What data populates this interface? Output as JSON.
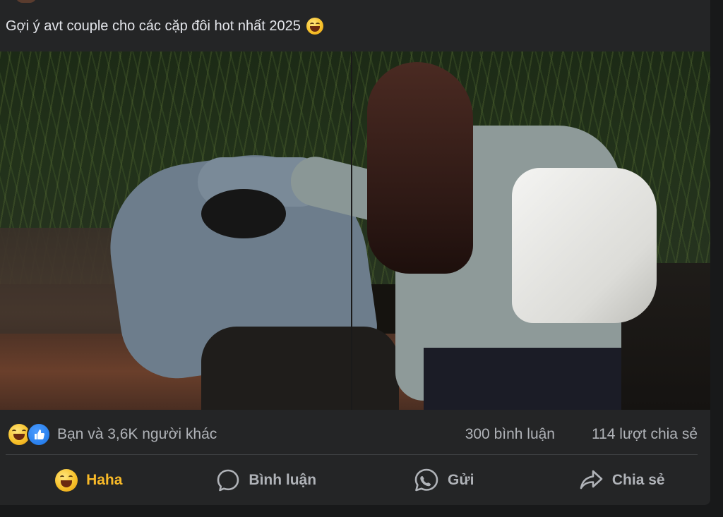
{
  "post": {
    "caption": "Gợi ý avt couple cho các cặp đôi hot nhất 2025",
    "caption_emoji": "laughing-emoji-icon"
  },
  "stats": {
    "reaction_icons": [
      "haha-reaction-icon",
      "like-reaction-icon"
    ],
    "reacted_by": "Bạn và 3,6K người khác",
    "comments": "300 bình luận",
    "shares": "114 lượt chia sẻ"
  },
  "actions": [
    {
      "label": "Haha",
      "icon": "haha-emoji-icon",
      "active": true
    },
    {
      "label": "Bình luận",
      "icon": "comment-icon",
      "active": false
    },
    {
      "label": "Gửi",
      "icon": "messenger-icon",
      "active": false
    },
    {
      "label": "Chia sẻ",
      "icon": "share-icon",
      "active": false
    }
  ],
  "colors": {
    "card_bg": "#242526",
    "text_primary": "#e4e6eb",
    "text_secondary": "#b0b3b8",
    "haha_active": "#f7b928",
    "like_blue": "#1b74e4"
  }
}
